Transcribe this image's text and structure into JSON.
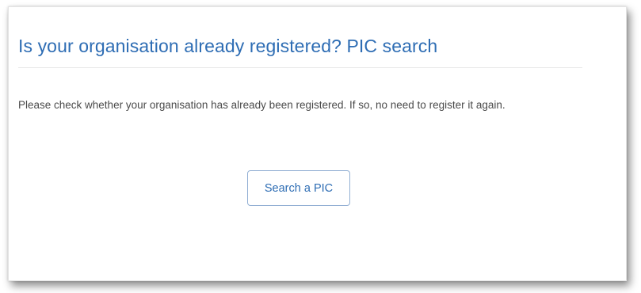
{
  "section": {
    "title": "Is your organisation already registered? PIC search",
    "description": "Please check whether your organisation has already been registered. If so, no need to register it again.",
    "search_button_label": "Search a PIC"
  },
  "colors": {
    "accent": "#2e6db4",
    "text": "#4a4a4a",
    "button_border": "#93b0d4"
  }
}
